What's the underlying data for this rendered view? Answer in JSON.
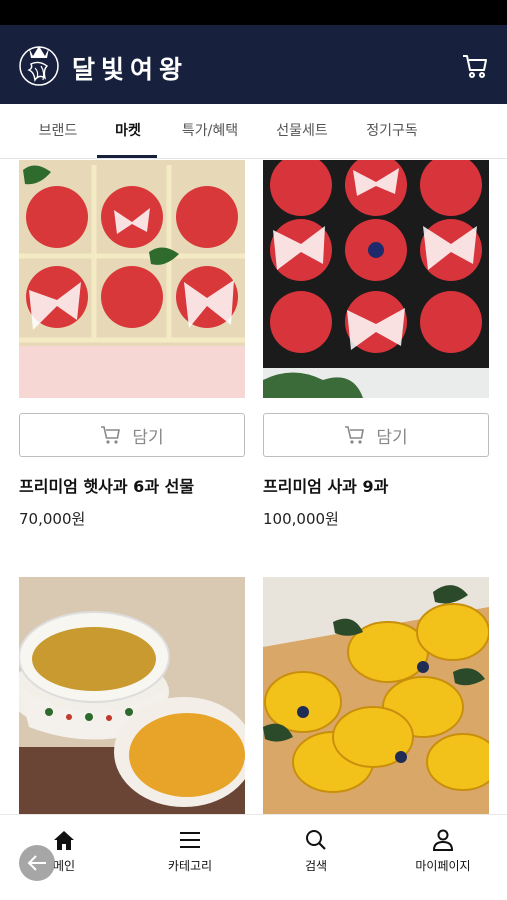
{
  "header": {
    "brand_name": "달빛여왕",
    "cart_icon": "cart-icon",
    "logo_icon": "queen-emblem-icon"
  },
  "tabs": [
    {
      "label": "브랜드",
      "active": false
    },
    {
      "label": "마켓",
      "active": true
    },
    {
      "label": "특가/혜택",
      "active": false
    },
    {
      "label": "선물세트",
      "active": false
    },
    {
      "label": "정기구독",
      "active": false
    }
  ],
  "products": [
    {
      "name": "프리미엄 햇사과 6과 선물",
      "price": "70,000원",
      "cart_label": "담기",
      "image": "apple-gift-box-6"
    },
    {
      "name": "프리미엄 사과 9과",
      "price": "100,000원",
      "cart_label": "담기",
      "image": "apple-gift-box-9"
    },
    {
      "image": "citron-tea"
    },
    {
      "image": "mango-box"
    }
  ],
  "bottom_nav": [
    {
      "label": "메인",
      "icon": "home-icon"
    },
    {
      "label": "카테고리",
      "icon": "menu-icon"
    },
    {
      "label": "검색",
      "icon": "search-icon"
    },
    {
      "label": "마이페이지",
      "icon": "user-icon"
    }
  ],
  "colors": {
    "header_bg": "#17213d",
    "accent": "#17213d"
  }
}
